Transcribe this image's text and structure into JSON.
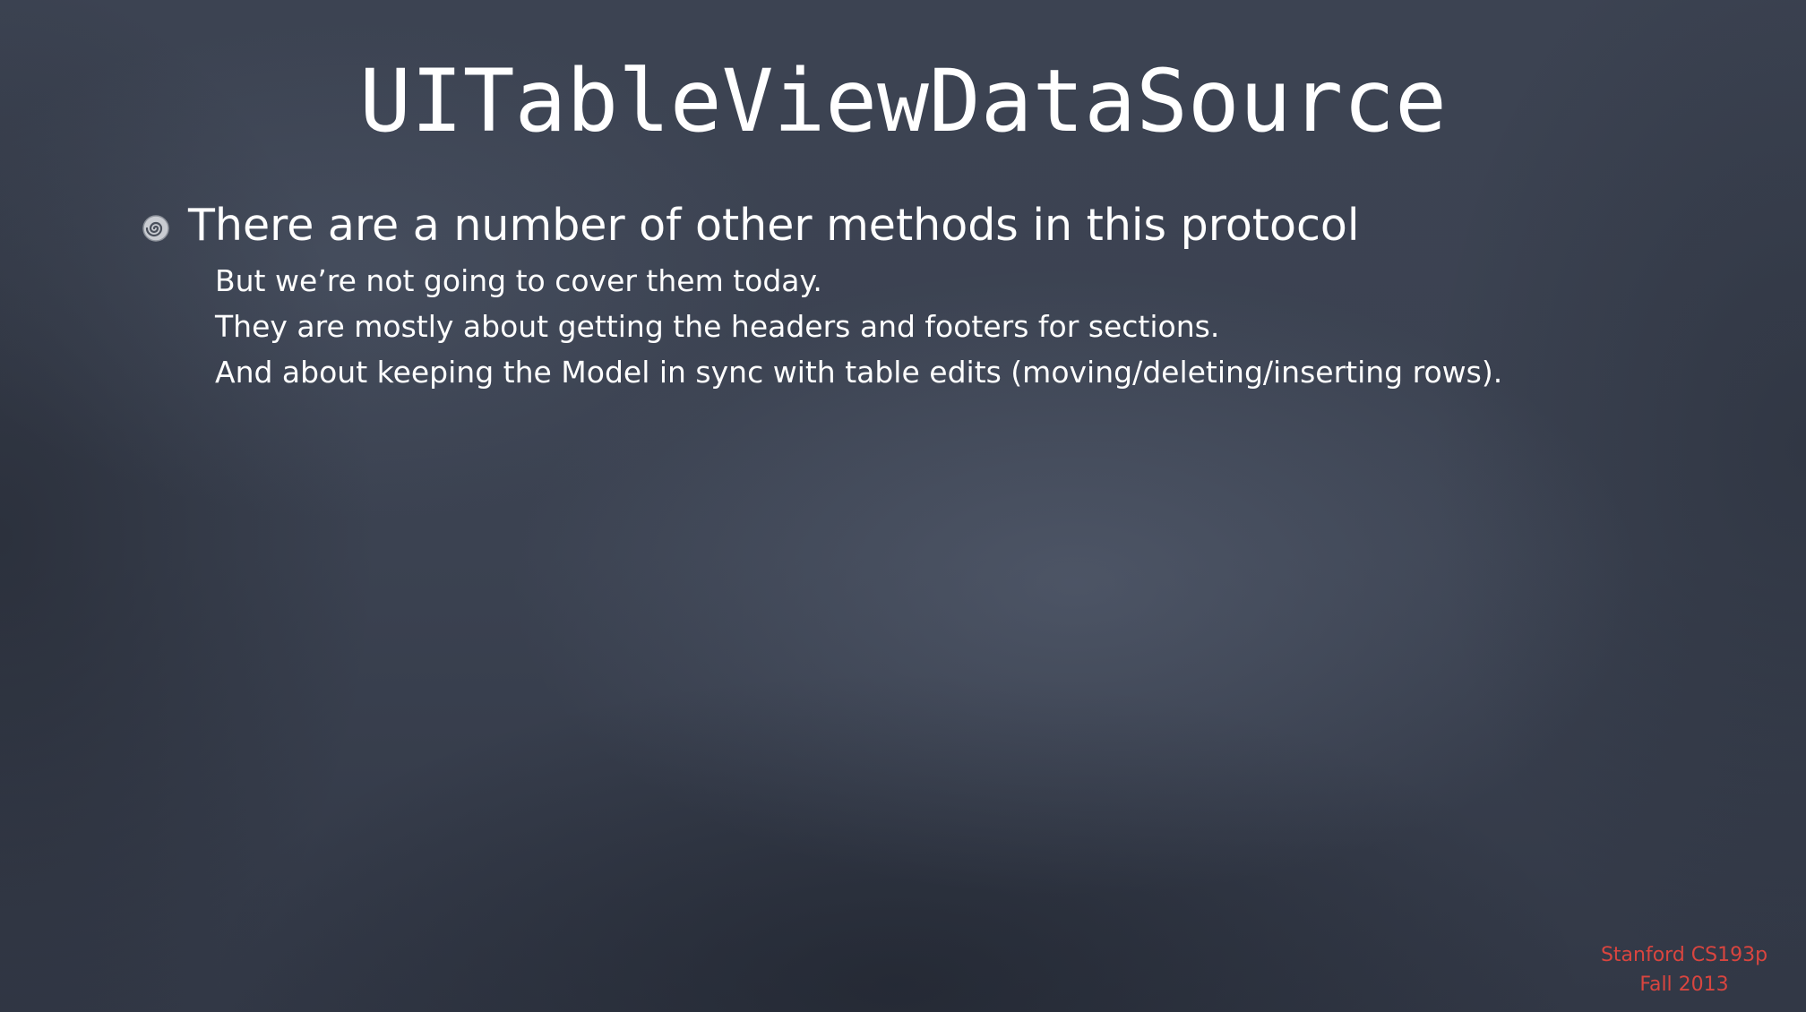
{
  "slide": {
    "title": "UITableViewDataSource",
    "bullet": {
      "icon": "spiral-bullet-icon",
      "text": "There are a number of other methods in this protocol",
      "sub_items": [
        "But we’re not going to cover them today.",
        "They are mostly about getting the headers and footers for sections.",
        "And about keeping the Model in sync with table edits (moving/deleting/inserting rows)."
      ]
    },
    "footer": {
      "line1": "Stanford CS193p",
      "line2": "Fall 2013",
      "color": "#d9453f"
    }
  },
  "colors": {
    "background": "#3a4150",
    "text": "#ffffff"
  }
}
